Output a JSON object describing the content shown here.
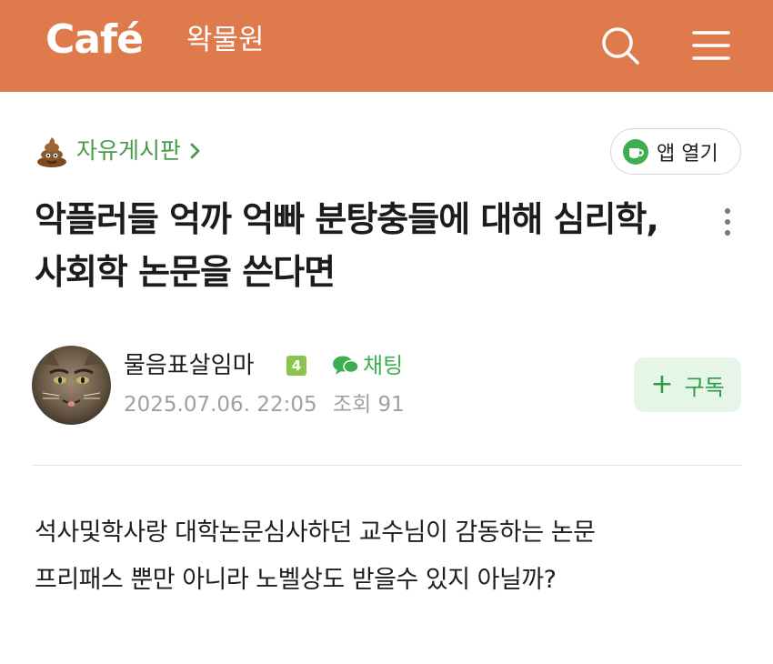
{
  "header": {
    "logo": "Café",
    "cafe_name": "왁물원",
    "brand_color": "#de7a4b",
    "search_icon": "search-icon",
    "menu_icon": "hamburger-menu-icon"
  },
  "board": {
    "emoji_icon": "poop-emoji-icon",
    "name": "자유게시판",
    "chevron": "›"
  },
  "app_open": {
    "icon": "coffee-cup-icon",
    "label": "앱 열기"
  },
  "post": {
    "title": "악플러들 억까 억빠 분탕충들에 대해 심리학, 사회학 논문을 쓴다면",
    "author": "물음표살임마",
    "level": "4",
    "chat_label": "채팅",
    "date": "2025.07.06. 22:05",
    "views": "조회 91",
    "subscribe_plus": "+",
    "subscribe_label": "구독",
    "body_lines": [
      "석사및학사랑 대학논문심사하던 교수님이 감동하는 논문",
      "프리패스 뿐만 아니라 노벨상도 받을수 있지 아닐까?"
    ]
  }
}
